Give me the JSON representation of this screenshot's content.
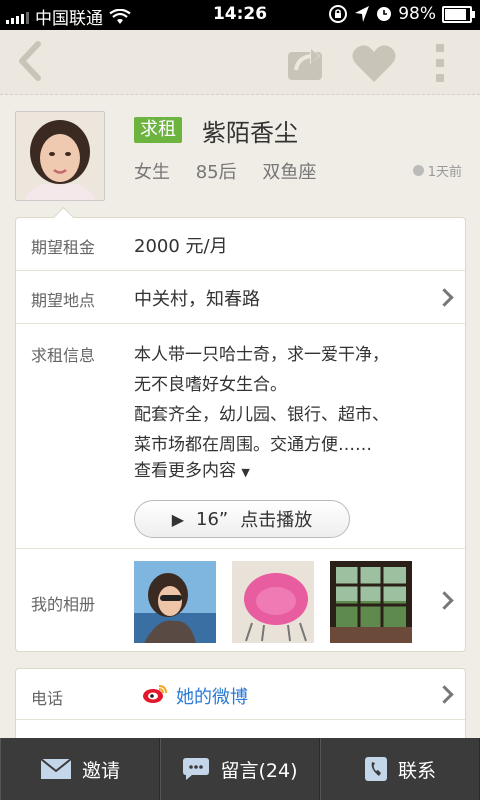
{
  "status_bar": {
    "carrier": "中国联通",
    "time": "14:26",
    "battery_percent": "98%"
  },
  "profile": {
    "tag": "求租",
    "name": "紫陌香尘",
    "gender": "女生",
    "age_group": "85后",
    "zodiac": "双鱼座",
    "time_ago": "1天前"
  },
  "details": {
    "rent": {
      "label": "期望租金",
      "value": "2000 元/月"
    },
    "location": {
      "label": "期望地点",
      "value": "中关村，知春路"
    },
    "info": {
      "label": "求租信息",
      "lines": [
        "本人带一只哈士奇，求一爱干净，",
        "无不良嗜好女生合。",
        "配套齐全，幼儿园、银行、超市、",
        "菜市场都在周围。交通方便……"
      ],
      "more": "查看更多内容",
      "audio_duration": "16”",
      "audio_action": "点击播放"
    },
    "album": {
      "label": "我的相册",
      "photos": [
        "portrait-photo",
        "pink-chair-photo",
        "window-view-photo"
      ]
    }
  },
  "contact": {
    "phone": {
      "label": "电话",
      "weibo": "她的微博"
    }
  },
  "tabbar": {
    "invite": "邀请",
    "message": "留言(24)",
    "contact": "联系"
  },
  "colors": {
    "tag_green": "#6db33f",
    "link_blue": "#2d7bd6",
    "tabbar_bg": "#3b3b3b",
    "page_bg": "#f0ede6"
  }
}
